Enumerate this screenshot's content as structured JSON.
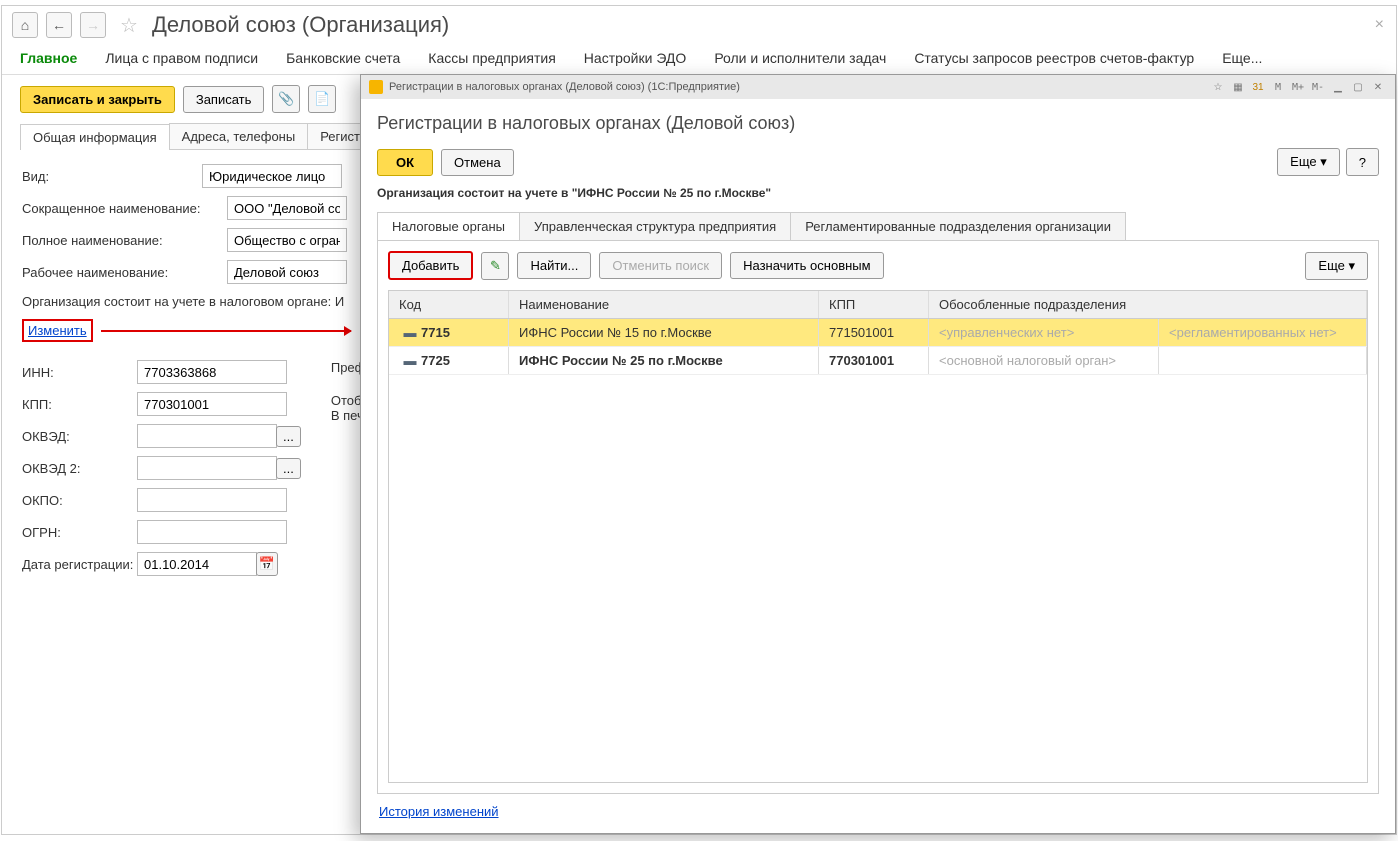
{
  "main": {
    "title": "Деловой союз (Организация)",
    "menu": [
      "Главное",
      "Лица с правом подписи",
      "Банковские счета",
      "Кассы предприятия",
      "Настройки ЭДО",
      "Роли и исполнители задач",
      "Статусы запросов реестров счетов-фактур",
      "Еще..."
    ],
    "save_close": "Записать и закрыть",
    "save": "Записать",
    "tabs": [
      "Общая информация",
      "Адреса, телефоны",
      "Регистр"
    ],
    "form": {
      "vid_lbl": "Вид:",
      "vid_val": "Юридическое лицо",
      "short_lbl": "Сокращенное наименование:",
      "short_val": "ООО \"Деловой союз\"",
      "full_lbl": "Полное наименование:",
      "full_val": "Общество с ограничен",
      "work_lbl": "Рабочее наименование:",
      "work_val": "Деловой союз",
      "tax_line": "Организация состоит на учете в налоговом органе: И",
      "change": "Изменить",
      "inn_lbl": "ИНН:",
      "inn_val": "7703363868",
      "kpp_lbl": "КПП:",
      "kpp_val": "770301001",
      "okved_lbl": "ОКВЭД:",
      "okved2_lbl": "ОКВЭД 2:",
      "okpo_lbl": "ОКПО:",
      "ogrn_lbl": "ОГРН:",
      "date_lbl": "Дата регистрации:",
      "date_val": "01.10.2014",
      "prefix_hint": "Префи",
      "note1": "Отобра",
      "note2": "В печа"
    }
  },
  "dlg": {
    "wintitle": "Регистрации в налоговых органах (Деловой союз)  (1С:Предприятие)",
    "heading": "Регистрации в налоговых органах (Деловой союз)",
    "ok": "ОК",
    "cancel": "Отмена",
    "more": "Еще",
    "help": "?",
    "info": "Организация состоит на учете в \"ИФНС России № 25 по г.Москве\"",
    "tabs": [
      "Налоговые органы",
      "Управленческая структура предприятия",
      "Регламентированные подразделения организации"
    ],
    "tb": {
      "add": "Добавить",
      "find": "Найти...",
      "cancel_find": "Отменить поиск",
      "set_main": "Назначить основным",
      "more": "Еще"
    },
    "cols": {
      "code": "Код",
      "name": "Наименование",
      "kpp": "КПП",
      "sub": "Обособленные подразделения"
    },
    "rows": [
      {
        "code": "7715",
        "name": "ИФНС России № 15 по г.Москве",
        "kpp": "771501001",
        "sub1": "<управленческих нет>",
        "sub2": "<регламентированных нет>",
        "selected": true
      },
      {
        "code": "7725",
        "name": "ИФНС России № 25 по г.Москве",
        "kpp": "770301001",
        "sub1": "<основной налоговый орган>",
        "sub2": "",
        "selected": false
      }
    ],
    "history": "История изменений",
    "sys": {
      "m": "M",
      "mp": "M+",
      "mm": "M-"
    }
  }
}
